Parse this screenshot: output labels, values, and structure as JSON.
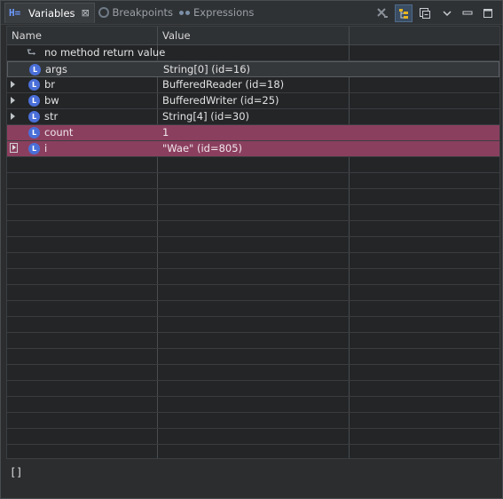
{
  "tabs": [
    {
      "label": "Variables",
      "icon": "variables-icon",
      "active": true
    },
    {
      "label": "Breakpoints",
      "icon": "breakpoints-icon",
      "active": false
    },
    {
      "label": "Expressions",
      "icon": "expressions-icon",
      "active": false
    }
  ],
  "toolbar": {
    "items": [
      "remove-all-icon",
      "show-type-names-icon",
      "collapse-all-icon",
      "view-menu-icon",
      "minimize-icon",
      "maximize-icon"
    ]
  },
  "columns": {
    "name": "Name",
    "value": "Value"
  },
  "rows": [
    {
      "name": "no method return value",
      "value": "",
      "icon": "return-icon",
      "expandable": false
    },
    {
      "name": "args",
      "value": "String[0]  (id=16)",
      "icon": "local-variable-icon",
      "expandable": false,
      "selected": true
    },
    {
      "name": "br",
      "value": "BufferedReader  (id=18)",
      "icon": "local-variable-icon",
      "expandable": true
    },
    {
      "name": "bw",
      "value": "BufferedWriter  (id=25)",
      "icon": "local-variable-icon",
      "expandable": true
    },
    {
      "name": "str",
      "value": "String[4]  (id=30)",
      "icon": "local-variable-icon",
      "expandable": true
    },
    {
      "name": "count",
      "value": "1",
      "icon": "local-variable-icon",
      "expandable": false,
      "changed": true
    },
    {
      "name": "i",
      "value": "\"Wae\" (id=805)",
      "icon": "local-variable-icon",
      "expandable": true,
      "changed": true
    }
  ],
  "local_icon_letter": "L",
  "detail_text": "[]",
  "colors": {
    "changed_row": "#8b3f5f",
    "accent": "#4a6fd8"
  }
}
